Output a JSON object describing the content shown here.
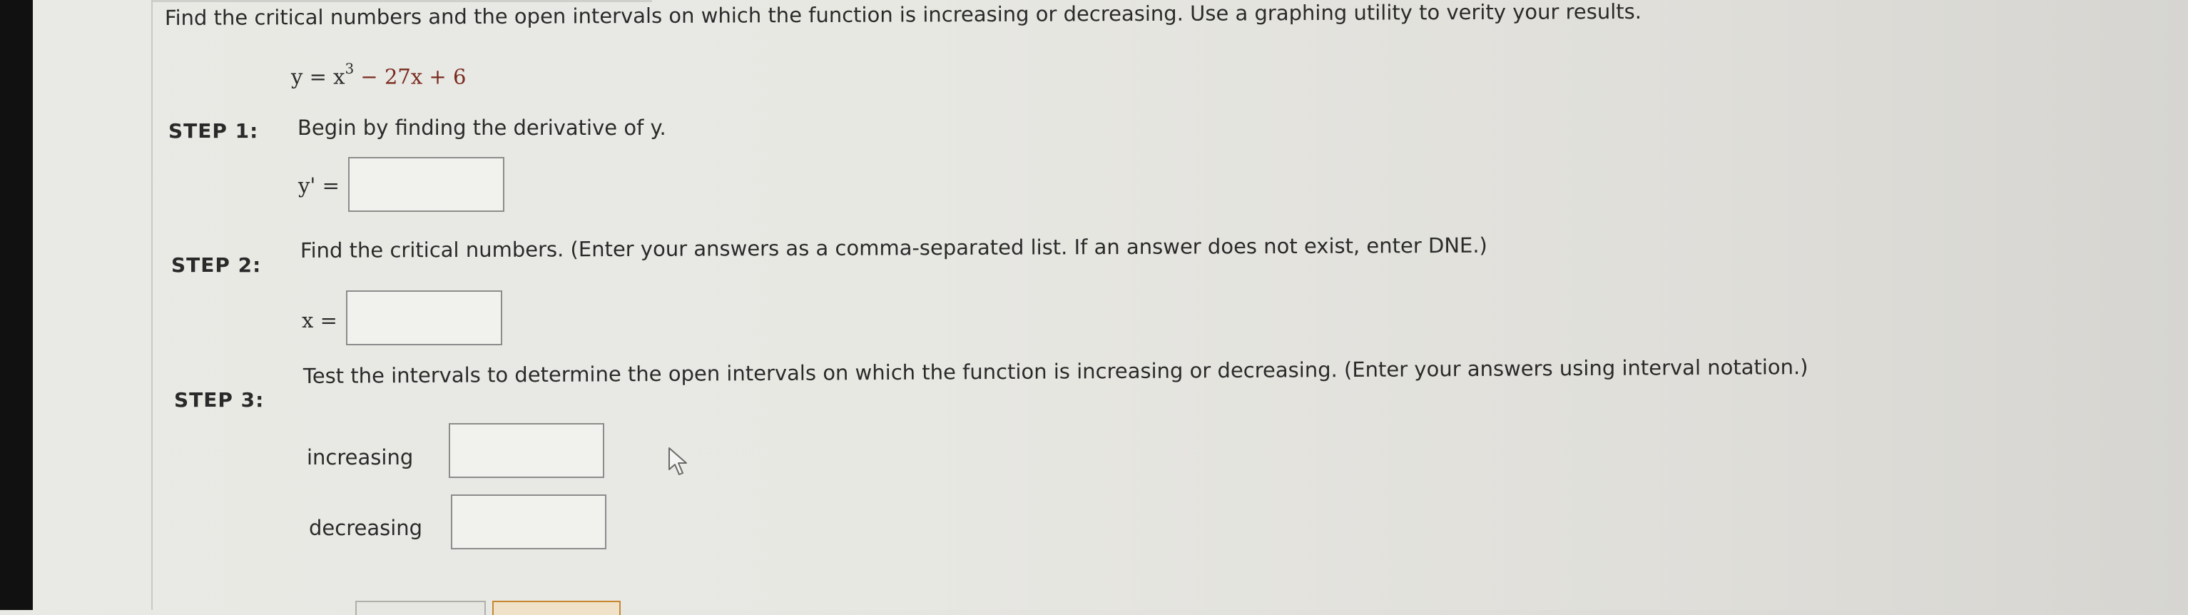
{
  "question": {
    "instructions": "Find the critical numbers and the open intervals on which the function is increasing or decreasing. Use a graphing utility to verity your results.",
    "function_lhs": "y = x",
    "function_exp": "3",
    "function_rhs": " − 27x + 6"
  },
  "steps": [
    {
      "label": "STEP 1:",
      "text": "Begin by finding the derivative of y.",
      "input_label": "y' =",
      "value": ""
    },
    {
      "label": "STEP 2:",
      "text": "Find the critical numbers. (Enter your answers as a comma-separated list. If an answer does not exist, enter DNE.)",
      "input_label": "x =",
      "value": ""
    },
    {
      "label": "STEP 3:",
      "text": "Test the intervals to determine the open intervals on which the function is increasing or decreasing. (Enter your answers using interval notation.)",
      "increasing_label": "increasing",
      "decreasing_label": "decreasing",
      "increasing_value": "",
      "decreasing_value": ""
    }
  ],
  "colors": {
    "function_color": "#7a2a1e",
    "box_border": "#8c8c8c",
    "submit_accent": "#c9872f"
  },
  "icons": {
    "cursor": "arrow-cursor-icon"
  }
}
